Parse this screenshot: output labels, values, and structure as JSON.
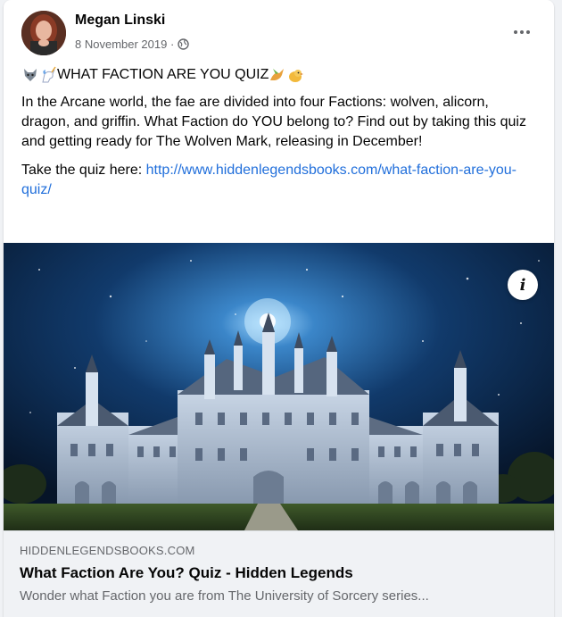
{
  "post": {
    "author": "Megan Linski",
    "date": "8 November 2019 ·",
    "privacy_icon": "globe-icon",
    "title": "WHAT FACTION ARE YOU QUIZ",
    "body": "In the Arcane world, the fae are divided into four Factions: wolven, alicorn, dragon, and griffin. What Faction do YOU belong to? Find out by taking this quiz and getting ready for The Wolven Mark, releasing in December!",
    "quiz_prefix": "Take the quiz here: ",
    "quiz_link": "http://www.hiddenlegendsbooks.com/what-faction-are-you-quiz/"
  },
  "link_preview": {
    "domain": "HIDDENLEGENDSBOOKS.COM",
    "title": "What Faction Are You? Quiz - Hidden Legends",
    "description": "Wonder what Faction you are from The University of Sorcery series...",
    "info_label": "i"
  },
  "colors": {
    "link": "#216fdb",
    "secondary_text": "#65676b",
    "caption_bg": "#f0f2f5"
  }
}
